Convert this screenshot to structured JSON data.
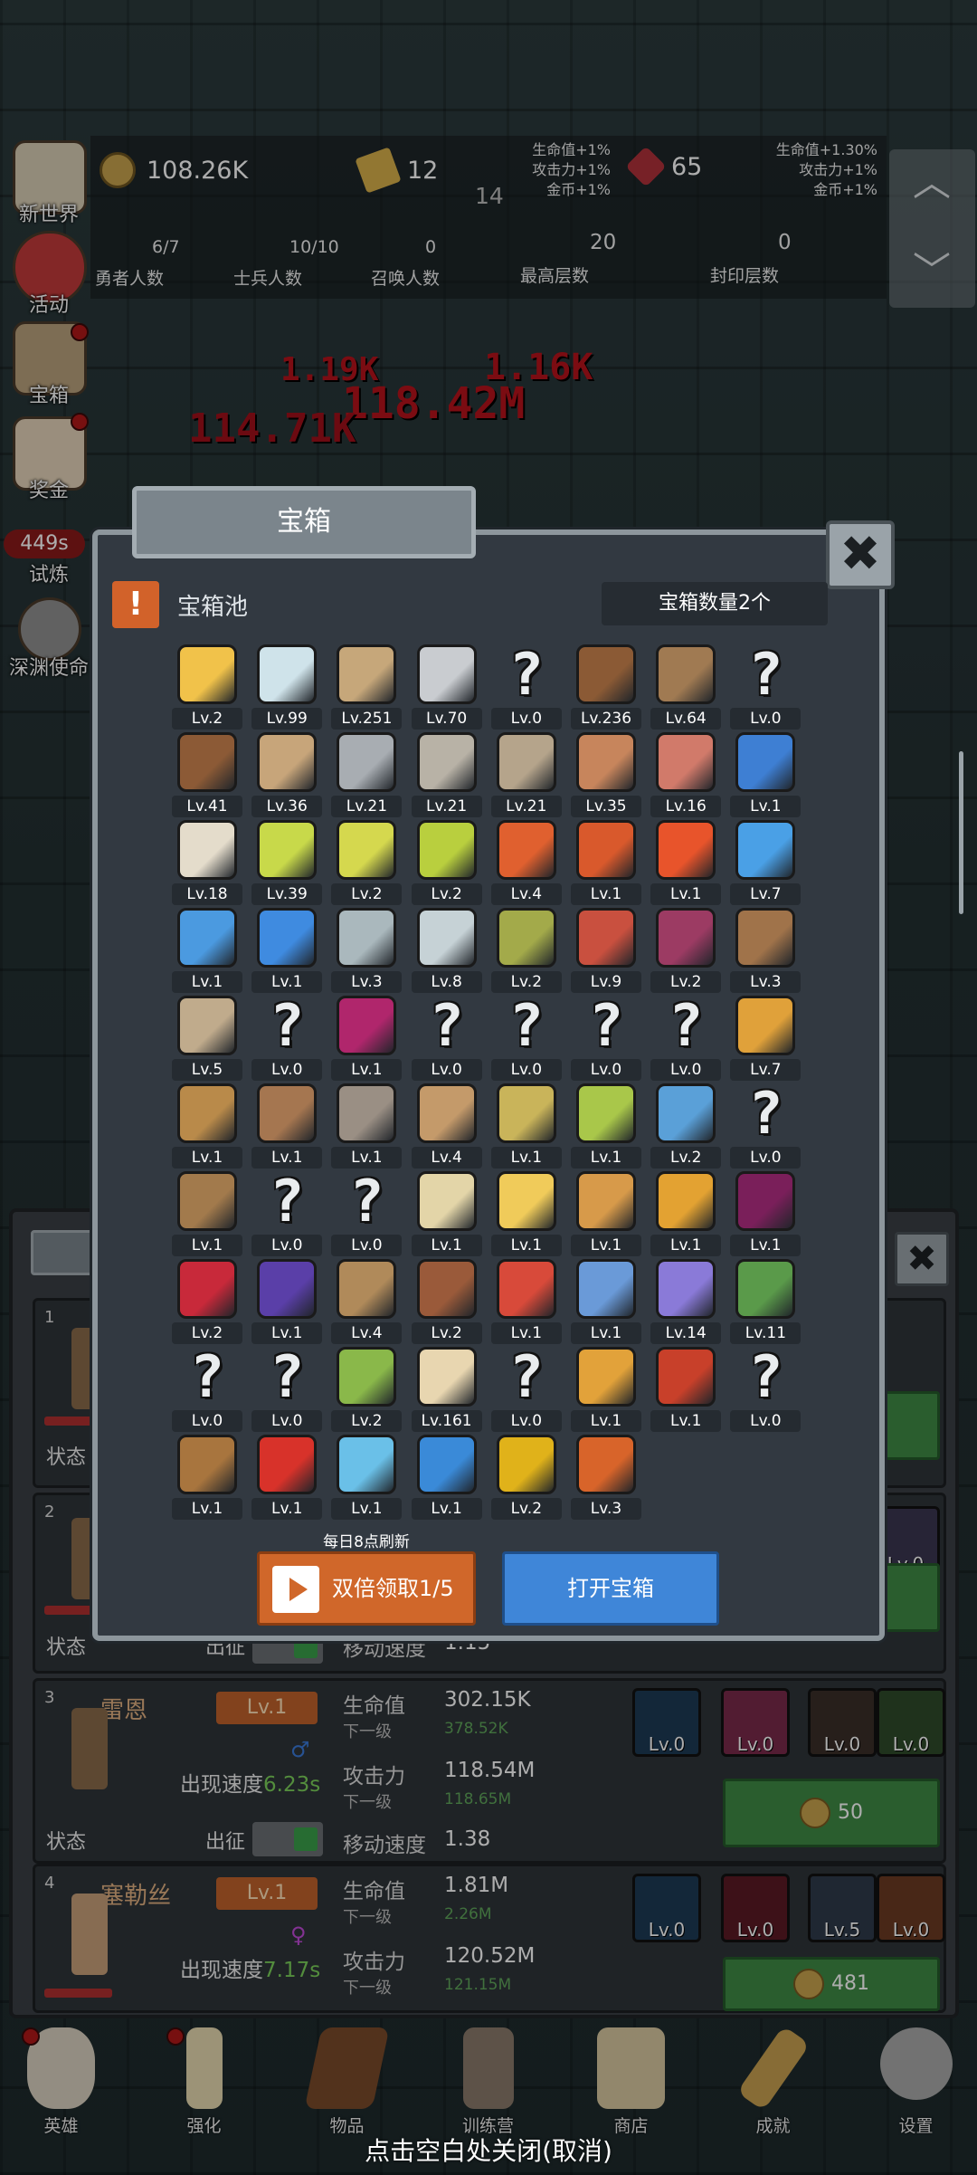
{
  "hud": {
    "gold": "108.26K",
    "bars": "12",
    "floor_num": "14",
    "gems": "65",
    "buff_left": [
      "生命值+1%",
      "攻击力+1%",
      "金币+1%"
    ],
    "buff_right": [
      "生命值+1.30%",
      "攻击力+1%",
      "金币+1%"
    ],
    "counters": [
      {
        "value": "6/7",
        "label": "勇者人数"
      },
      {
        "value": "10/10",
        "label": "士兵人数"
      },
      {
        "value": "0",
        "label": "召唤人数"
      },
      {
        "value": "20",
        "label": "最高层数"
      },
      {
        "value": "0",
        "label": "封印层数"
      }
    ]
  },
  "side_menu": [
    {
      "label": "新世界",
      "icon": "scroll-map-icon",
      "color": "#d8cdb4",
      "dot": false
    },
    {
      "label": "活动",
      "icon": "heart-icon",
      "color": "#c23a3a",
      "dot": false
    },
    {
      "label": "宝箱",
      "icon": "chest-icon",
      "color": "#b9a17c",
      "dot": true
    },
    {
      "label": "奖金",
      "icon": "envelope-icon",
      "color": "#e3d2b8",
      "dot": true
    },
    {
      "label": "试炼",
      "icon": "trial-icon",
      "color": "#5a5f63",
      "dot": false,
      "timer": "449s"
    },
    {
      "label": "深渊使命",
      "icon": "abyss-orb-icon",
      "color": "#8f8f8f",
      "dot": false
    }
  ],
  "damage_texts": [
    "1.19K",
    "1.16K",
    "118.42M",
    "114.71K"
  ],
  "modal": {
    "tab_title": "宝箱",
    "pool_title": "宝箱池",
    "count_label": "宝箱数量2个",
    "close_symbol": "✖",
    "refresh_note": "每日8点刷新",
    "double_btn": "双倍领取1/5",
    "open_btn": "打开宝箱",
    "items": [
      {
        "lv": "Lv.2",
        "icon": "crown-icon",
        "c": "#f1c24a"
      },
      {
        "lv": "Lv.99",
        "icon": "diamond-icon",
        "c": "#cfe3ea"
      },
      {
        "lv": "Lv.251",
        "icon": "sword-icon",
        "c": "#c6a77a"
      },
      {
        "lv": "Lv.70",
        "icon": "steel-sword-icon",
        "c": "#c9ccd0"
      },
      {
        "lv": "Lv.0",
        "icon": "unknown-icon",
        "q": true
      },
      {
        "lv": "Lv.236",
        "icon": "leather-armor-icon",
        "c": "#8b5a35"
      },
      {
        "lv": "Lv.64",
        "icon": "backpack-armor-icon",
        "c": "#a07a52"
      },
      {
        "lv": "Lv.0",
        "icon": "unknown-icon",
        "q": true
      },
      {
        "lv": "Lv.41",
        "icon": "leather-helmet-icon",
        "c": "#8c5a36"
      },
      {
        "lv": "Lv.36",
        "icon": "dagger-icon",
        "c": "#c7a57a"
      },
      {
        "lv": "Lv.21",
        "icon": "knight-helmet-icon",
        "c": "#a8adb2"
      },
      {
        "lv": "Lv.21",
        "icon": "hammer-icon",
        "c": "#b8b2a6"
      },
      {
        "lv": "Lv.21",
        "icon": "great-helm-icon",
        "c": "#b5a48b"
      },
      {
        "lv": "Lv.35",
        "icon": "ham-icon",
        "c": "#c7855c"
      },
      {
        "lv": "Lv.16",
        "icon": "steak-icon",
        "c": "#d17a6a"
      },
      {
        "lv": "Lv.1",
        "icon": "blue-pouch-icon",
        "c": "#3e7fd3"
      },
      {
        "lv": "Lv.18",
        "icon": "flour-bowl-icon",
        "c": "#e4dccb"
      },
      {
        "lv": "Lv.39",
        "icon": "yellow-potion-icon",
        "c": "#c8d94a"
      },
      {
        "lv": "Lv.2",
        "icon": "yellow-flask-icon",
        "c": "#d5d84e"
      },
      {
        "lv": "Lv.2",
        "icon": "green-potion-icon",
        "c": "#b9cf3e"
      },
      {
        "lv": "Lv.4",
        "icon": "red-flask-icon",
        "c": "#e0602f"
      },
      {
        "lv": "Lv.1",
        "icon": "red-jar-icon",
        "c": "#d9592c"
      },
      {
        "lv": "Lv.1",
        "icon": "red-potion-icon",
        "c": "#e8542b"
      },
      {
        "lv": "Lv.7",
        "icon": "blue-flask-icon",
        "c": "#4aa0e6"
      },
      {
        "lv": "Lv.1",
        "icon": "blue-jar-icon",
        "c": "#4b9ae0"
      },
      {
        "lv": "Lv.1",
        "icon": "blue-potion-icon",
        "c": "#3f8be0"
      },
      {
        "lv": "Lv.3",
        "icon": "grey-vial-icon",
        "c": "#aab8bd"
      },
      {
        "lv": "Lv.8",
        "icon": "white-vial-icon",
        "c": "#c6d2d6"
      },
      {
        "lv": "Lv.2",
        "icon": "olive-bottle-icon",
        "c": "#a3aa4a"
      },
      {
        "lv": "Lv.9",
        "icon": "red-bottle-icon",
        "c": "#c9503f"
      },
      {
        "lv": "Lv.2",
        "icon": "winged-boot-icon",
        "c": "#9c3b63"
      },
      {
        "lv": "Lv.3",
        "icon": "leather-boot-icon",
        "c": "#a0734a"
      },
      {
        "lv": "Lv.5",
        "icon": "cloth-boot-icon",
        "c": "#c0ab8c"
      },
      {
        "lv": "Lv.0",
        "icon": "unknown-icon",
        "q": true
      },
      {
        "lv": "Lv.1",
        "icon": "magic-boots-icon",
        "c": "#b0266c"
      },
      {
        "lv": "Lv.0",
        "icon": "unknown-icon",
        "q": true
      },
      {
        "lv": "Lv.0",
        "icon": "unknown-icon",
        "q": true
      },
      {
        "lv": "Lv.0",
        "icon": "unknown-icon",
        "q": true
      },
      {
        "lv": "Lv.0",
        "icon": "unknown-icon",
        "q": true
      },
      {
        "lv": "Lv.7",
        "icon": "torch-icon",
        "c": "#e0a13a"
      },
      {
        "lv": "Lv.1",
        "icon": "wooden-staff-icon",
        "c": "#b98a4a"
      },
      {
        "lv": "Lv.1",
        "icon": "mushroom-icon",
        "c": "#a57650"
      },
      {
        "lv": "Lv.1",
        "icon": "pickaxe-icon",
        "c": "#9a8f84"
      },
      {
        "lv": "Lv.4",
        "icon": "crook-staff-icon",
        "c": "#c49a6a"
      },
      {
        "lv": "Lv.1",
        "icon": "potato-icon",
        "c": "#c9b45a"
      },
      {
        "lv": "Lv.1",
        "icon": "green-fruit-icon",
        "c": "#a9c74a"
      },
      {
        "lv": "Lv.2",
        "icon": "blue-scepter-icon",
        "c": "#5aa0d8"
      },
      {
        "lv": "Lv.0",
        "icon": "unknown-icon",
        "q": true
      },
      {
        "lv": "Lv.1",
        "icon": "travel-pack-icon",
        "c": "#a27a4c"
      },
      {
        "lv": "Lv.0",
        "icon": "unknown-icon",
        "q": true
      },
      {
        "lv": "Lv.0",
        "icon": "unknown-icon",
        "q": true
      },
      {
        "lv": "Lv.1",
        "icon": "bone-spear-icon",
        "c": "#e3d5a8"
      },
      {
        "lv": "Lv.1",
        "icon": "cheese-icon",
        "c": "#f0cb5a"
      },
      {
        "lv": "Lv.1",
        "icon": "pie-icon",
        "c": "#d79a4a"
      },
      {
        "lv": "Lv.1",
        "icon": "honey-jar-icon",
        "c": "#e3a232"
      },
      {
        "lv": "Lv.1",
        "icon": "dark-crystal-icon",
        "c": "#7a1f5a"
      },
      {
        "lv": "Lv.2",
        "icon": "red-orb-icon",
        "c": "#c8293a"
      },
      {
        "lv": "Lv.1",
        "icon": "fire-gem-icon",
        "c": "#5a3fa8"
      },
      {
        "lv": "Lv.4",
        "icon": "bow-icon",
        "c": "#b08a5a"
      },
      {
        "lv": "Lv.2",
        "icon": "quiver-icon",
        "c": "#9a5a3a"
      },
      {
        "lv": "Lv.1",
        "icon": "red-flower-icon",
        "c": "#d84a3a"
      },
      {
        "lv": "Lv.1",
        "icon": "blue-flower-icon",
        "c": "#6a9ad8"
      },
      {
        "lv": "Lv.14",
        "icon": "purple-flower-icon",
        "c": "#8a7ad8"
      },
      {
        "lv": "Lv.11",
        "icon": "green-amulet-icon",
        "c": "#5a9a4a"
      },
      {
        "lv": "Lv.0",
        "icon": "unknown-icon",
        "q": true
      },
      {
        "lv": "Lv.0",
        "icon": "unknown-icon",
        "q": true
      },
      {
        "lv": "Lv.2",
        "icon": "green-wand-icon",
        "c": "#8ab84a"
      },
      {
        "lv": "Lv.161",
        "icon": "ale-mug-icon",
        "c": "#e8d6b0"
      },
      {
        "lv": "Lv.0",
        "icon": "unknown-icon",
        "q": true
      },
      {
        "lv": "Lv.1",
        "icon": "golden-pickaxe-icon",
        "c": "#e2a23a"
      },
      {
        "lv": "Lv.1",
        "icon": "spell-book-icon",
        "c": "#c8402a"
      },
      {
        "lv": "Lv.0",
        "icon": "unknown-icon",
        "q": true
      },
      {
        "lv": "Lv.1",
        "icon": "whip-icon",
        "c": "#a8753e"
      },
      {
        "lv": "Lv.1",
        "icon": "red-banner-icon",
        "c": "#d8322a"
      },
      {
        "lv": "Lv.1",
        "icon": "crystal-ball-icon",
        "c": "#6ac0e8"
      },
      {
        "lv": "Lv.1",
        "icon": "rune-shield-icon",
        "c": "#3a8ad8"
      },
      {
        "lv": "Lv.2",
        "icon": "golden-orb-icon",
        "c": "#e0b21a"
      },
      {
        "lv": "Lv.3",
        "icon": "fire-arrow-icon",
        "c": "#d8642a"
      }
    ]
  },
  "hero_cards": [
    {
      "num": "1",
      "name": "",
      "lv": "",
      "speed_label": "",
      "speed": "",
      "state": "状态",
      "go": ""
    },
    {
      "num": "2",
      "name": "",
      "lv": "",
      "speed_label": "",
      "speed": "",
      "state": "状态",
      "go": "出征",
      "stats": [
        {
          "l": "移动速度",
          "v": "1.15"
        }
      ],
      "equip_lv": "Lv.0"
    },
    {
      "num": "3",
      "name": "雷恩",
      "lv": "Lv.1",
      "speed_label": "出现速度",
      "speed": "6.23s",
      "state": "状态",
      "go": "出征",
      "hp_label": "生命值",
      "hp": "302.15K",
      "hp_next_label": "下一级",
      "hp_next": "378.52K",
      "atk_label": "攻击力",
      "atk": "118.54M",
      "atk_next_label": "下一级",
      "atk_next": "118.65M",
      "move_label": "移动速度",
      "move": "1.38",
      "equip": [
        "Lv.0",
        "Lv.0",
        "Lv.0",
        "Lv.0"
      ],
      "cost": "50"
    },
    {
      "num": "4",
      "name": "塞勒丝",
      "lv": "Lv.1",
      "speed_label": "出现速度",
      "speed": "7.17s",
      "hp_label": "生命值",
      "hp": "1.81M",
      "hp_next_label": "下一级",
      "hp_next": "2.26M",
      "atk_label": "攻击力",
      "atk": "120.52M",
      "atk_next_label": "下一级",
      "atk_next": "121.15M",
      "equip": [
        "Lv.0",
        "Lv.0",
        "Lv.5",
        "Lv.0"
      ],
      "cost": "481"
    }
  ],
  "bottom_nav": [
    {
      "label": "英雄",
      "icon": "skull-icon",
      "color": "#d9d0c0",
      "dot": true
    },
    {
      "label": "强化",
      "icon": "candle-icon",
      "color": "#e6d9b0",
      "dot": true
    },
    {
      "label": "物品",
      "icon": "book-icon",
      "color": "#7a4a2a",
      "dot": false
    },
    {
      "label": "训练营",
      "icon": "lantern-icon",
      "color": "#8a7a6a",
      "dot": false
    },
    {
      "label": "商店",
      "icon": "beer-mug-icon",
      "color": "#d8c8a0",
      "dot": false
    },
    {
      "label": "成就",
      "icon": "key-icon",
      "color": "#c8a050",
      "dot": false
    },
    {
      "label": "设置",
      "icon": "gear-icon",
      "color": "#a8a8a8",
      "dot": false
    }
  ],
  "close_hint": "点击空白处关闭(取消)"
}
